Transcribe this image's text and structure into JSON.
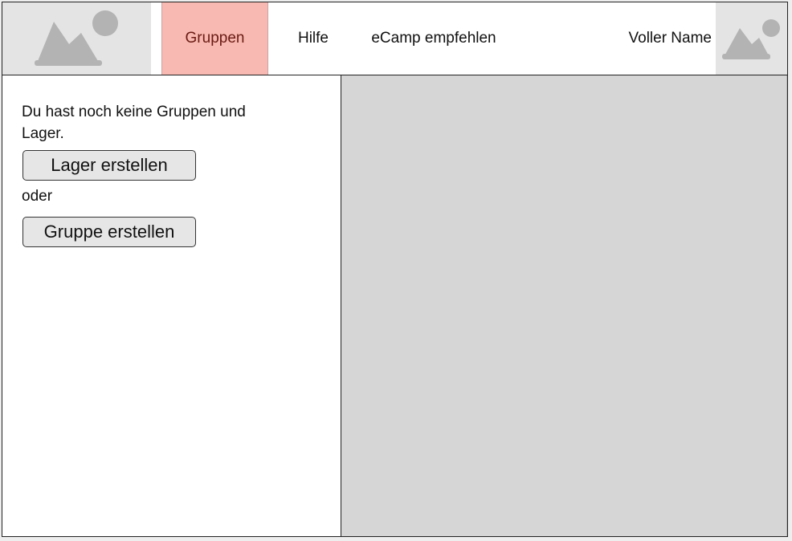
{
  "header": {
    "logo_icon": "image-placeholder-icon",
    "nav": [
      {
        "label": "Gruppen",
        "active": true
      },
      {
        "label": "Hilfe",
        "active": false
      },
      {
        "label": "eCamp empfehlen",
        "active": false
      }
    ],
    "user_name": "Voller Name",
    "avatar_icon": "image-placeholder-icon"
  },
  "sidebar": {
    "empty_message": "Du hast noch keine Gruppen und Lager.",
    "create_camp_label": "Lager erstellen",
    "or_label": "oder",
    "create_group_label": "Gruppe erstellen"
  },
  "colors": {
    "active_tab_bg": "#f7b9b1",
    "active_tab_text": "#6b1b14",
    "placeholder_bg": "#e4e4e4",
    "placeholder_icon": "#b3b3b3",
    "content_bg": "#d6d6d6",
    "button_bg": "#e6e6e6"
  }
}
